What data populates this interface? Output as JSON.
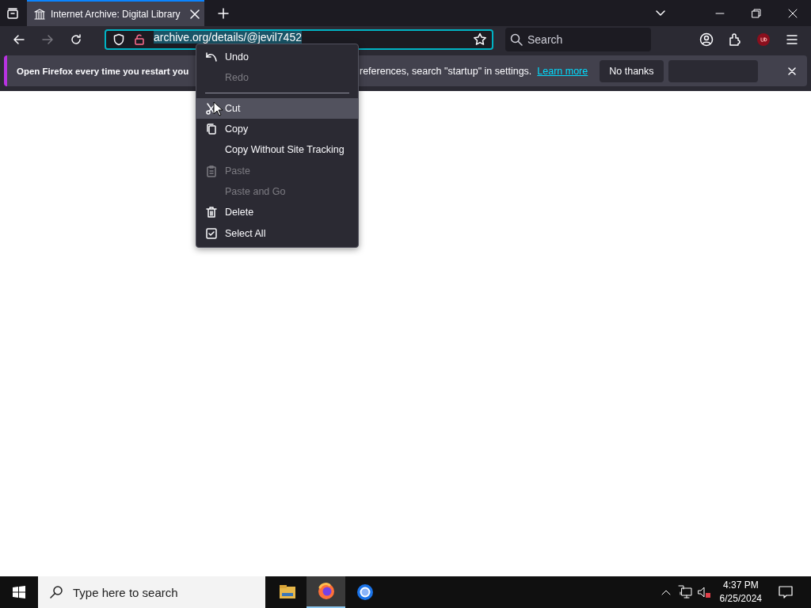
{
  "tabs": [
    {
      "title": "Internet Archive: Digital Library",
      "selected": true
    }
  ],
  "url_bar": {
    "value": "archive.org/details/@jevil7452",
    "selected": true
  },
  "search_field": {
    "placeholder": "Search"
  },
  "notification": {
    "text_start": "Open Firefox every time you restart you",
    "text_end": "references, search \"startup\" in settings.",
    "link": "Learn more",
    "button": "No thanks"
  },
  "context_menu": {
    "items": [
      {
        "kind": "item",
        "label": "Undo",
        "disabled": false,
        "selected": false
      },
      {
        "kind": "item",
        "label": "Redo",
        "disabled": true,
        "selected": false
      },
      {
        "kind": "separator"
      },
      {
        "kind": "item",
        "label": "Cut",
        "disabled": false,
        "selected": true
      },
      {
        "kind": "item",
        "label": "Copy",
        "disabled": false,
        "selected": false
      },
      {
        "kind": "item",
        "label": "Copy Without Site Tracking",
        "disabled": false,
        "selected": false
      },
      {
        "kind": "item",
        "label": "Paste",
        "disabled": true,
        "selected": false
      },
      {
        "kind": "item",
        "label": "Paste and Go",
        "disabled": true,
        "selected": false
      },
      {
        "kind": "item",
        "label": "Delete",
        "disabled": false,
        "selected": false
      },
      {
        "kind": "item",
        "label": "Select All",
        "disabled": false,
        "selected": false
      }
    ]
  },
  "taskbar": {
    "search_placeholder": "Type here to search",
    "apps": [
      {
        "selected": false
      },
      {
        "selected": true
      },
      {
        "selected": false
      }
    ],
    "time": "4:37 PM",
    "date": "6/25/2024"
  }
}
